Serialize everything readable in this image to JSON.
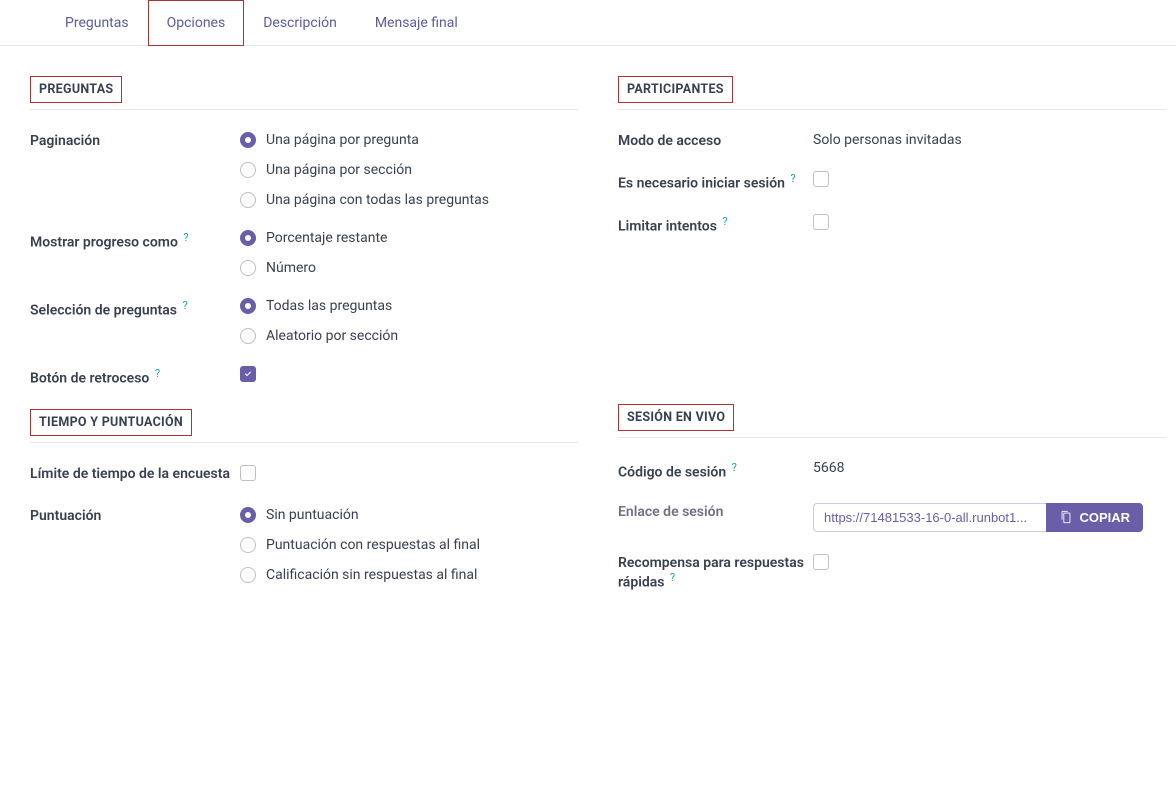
{
  "tabs": {
    "preguntas": "Preguntas",
    "opciones": "Opciones",
    "descripcion": "Descripción",
    "mensaje_final": "Mensaje final"
  },
  "sections": {
    "preguntas": "PREGUNTAS",
    "tiempo": "TIEMPO Y PUNTUACIÓN",
    "participantes": "PARTICIPANTES",
    "sesion": "SESIÓN EN VIVO"
  },
  "labels": {
    "paginacion": "Paginación",
    "paginacion_opts": {
      "por_pregunta": "Una página por pregunta",
      "por_seccion": "Una página por sección",
      "todas": "Una página con todas las preguntas"
    },
    "mostrar_progreso": "Mostrar progreso como",
    "progreso_opts": {
      "porcentaje": "Porcentaje restante",
      "numero": "Número"
    },
    "seleccion": "Selección de preguntas",
    "seleccion_opts": {
      "todas": "Todas las preguntas",
      "aleatorio": "Aleatorio por sección"
    },
    "retroceso": "Botón de retroceso",
    "limite_tiempo": "Límite de tiempo de la encuesta",
    "puntuacion": "Puntuación",
    "puntuacion_opts": {
      "sin": "Sin puntuación",
      "con_resp": "Puntuación con respuestas al final",
      "calif_sin": "Calificación sin respuestas al final"
    },
    "modo_acceso": "Modo de acceso",
    "modo_acceso_val": "Solo personas invitadas",
    "login": "Es necesario iniciar sesión",
    "limitar_intentos": "Limitar intentos",
    "codigo_sesion": "Código de sesión",
    "codigo_val": "5668",
    "enlace_sesion": "Enlace de sesión",
    "enlace_val": "https://71481533-16-0-all.runbot1...",
    "copiar": "COPIAR",
    "recompensa": "Recompensa para respuestas rápidas",
    "help": "?"
  }
}
